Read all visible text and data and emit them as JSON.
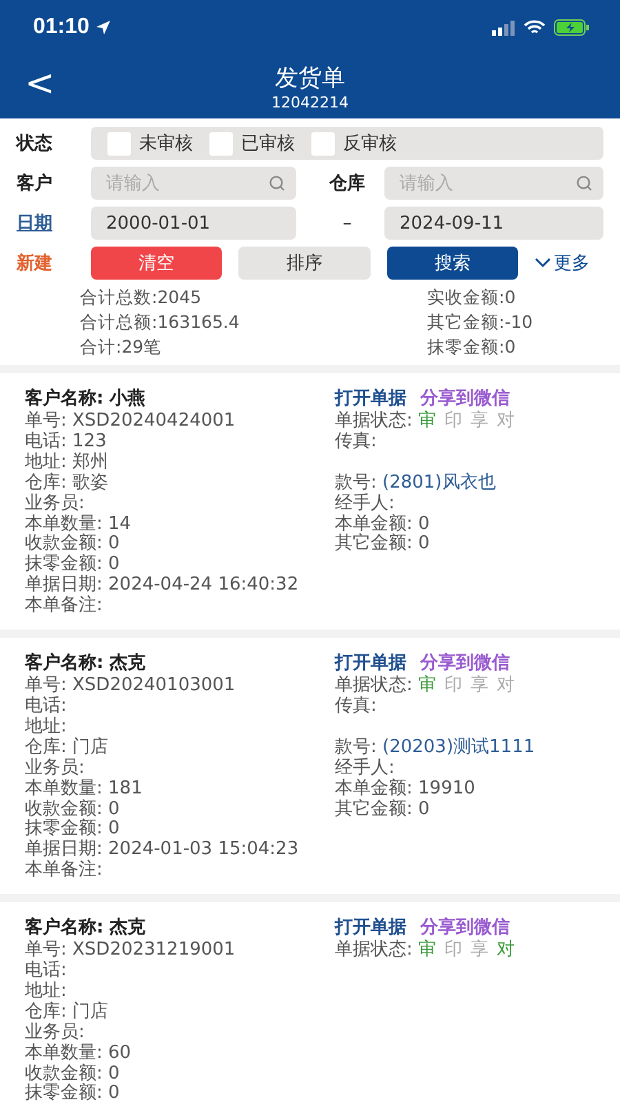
{
  "status_bar": {
    "time": "01:10"
  },
  "nav": {
    "back": "<",
    "title": "发货单",
    "subtitle": "12042214"
  },
  "filters": {
    "status_label": "状态",
    "status_options": [
      {
        "label": "未审核",
        "checked": false
      },
      {
        "label": "已审核",
        "checked": false
      },
      {
        "label": "反审核",
        "checked": false
      }
    ],
    "customer_label": "客户",
    "customer_placeholder": "请输入",
    "warehouse_label": "仓库",
    "warehouse_placeholder": "请输入",
    "date_label": "日期",
    "date_from": "2000-01-01",
    "date_sep": "–",
    "date_to": "2024-09-11",
    "new_label": "新建",
    "clear": "清空",
    "sort": "排序",
    "search": "搜索",
    "more": "更多"
  },
  "summary": {
    "left": [
      "合计总数:2045",
      "合计总额:163165.4",
      "合计:29笔"
    ],
    "right": [
      "实收金额:0",
      "其它金额:-10",
      "抹零金额:0"
    ]
  },
  "orders": [
    {
      "customer_label": "客户名称:",
      "customer": "小燕",
      "open": "打开单据",
      "share": "分享到微信",
      "rows": [
        {
          "left": {
            "label": "单号:",
            "value": "XSD20240424001"
          },
          "right": {
            "kind": "status",
            "label": "单据状态:",
            "flags": [
              {
                "text": "审",
                "on": true
              },
              {
                "text": "印",
                "on": false
              },
              {
                "text": "享",
                "on": false
              },
              {
                "text": "对",
                "on": false
              }
            ]
          }
        },
        {
          "left": {
            "label": "电话:",
            "value": "123"
          },
          "right": {
            "kind": "field",
            "label": "传真:"
          }
        },
        {
          "left": {
            "label": "地址:",
            "value": "郑州"
          }
        },
        {
          "left": {
            "label": "仓库:",
            "value": "歌姿"
          },
          "right": {
            "kind": "style",
            "label": "款号:",
            "value": "(2801)风衣也"
          }
        },
        {
          "left": {
            "label": "业务员:"
          },
          "right": {
            "kind": "field",
            "label": "经手人:"
          }
        },
        {
          "left": {
            "label": "本单数量:",
            "value": "14"
          },
          "right": {
            "kind": "field",
            "label": "本单金额:",
            "value": "0"
          }
        },
        {
          "left": {
            "label": "收款金额:",
            "value": "0"
          },
          "right": {
            "kind": "field",
            "label": "其它金额:",
            "value": "0"
          }
        },
        {
          "left": {
            "label": "抹零金额:",
            "value": "0"
          }
        },
        {
          "left": {
            "label": "单据日期:",
            "value": "2024-04-24 16:40:32"
          }
        },
        {
          "left": {
            "label": "本单备注:"
          }
        }
      ]
    },
    {
      "customer_label": "客户名称:",
      "customer": "杰克",
      "open": "打开单据",
      "share": "分享到微信",
      "rows": [
        {
          "left": {
            "label": "单号:",
            "value": "XSD20240103001"
          },
          "right": {
            "kind": "status",
            "label": "单据状态:",
            "flags": [
              {
                "text": "审",
                "on": true
              },
              {
                "text": "印",
                "on": false
              },
              {
                "text": "享",
                "on": false
              },
              {
                "text": "对",
                "on": false
              }
            ]
          }
        },
        {
          "left": {
            "label": "电话:"
          },
          "right": {
            "kind": "field",
            "label": "传真:"
          }
        },
        {
          "left": {
            "label": "地址:"
          }
        },
        {
          "left": {
            "label": "仓库:",
            "value": "门店"
          },
          "right": {
            "kind": "style",
            "label": "款号:",
            "value": "(20203)测试1111"
          }
        },
        {
          "left": {
            "label": "业务员:"
          },
          "right": {
            "kind": "field",
            "label": "经手人:"
          }
        },
        {
          "left": {
            "label": "本单数量:",
            "value": "181"
          },
          "right": {
            "kind": "field",
            "label": "本单金额:",
            "value": "19910"
          }
        },
        {
          "left": {
            "label": "收款金额:",
            "value": "0"
          },
          "right": {
            "kind": "field",
            "label": "其它金额:",
            "value": "0"
          }
        },
        {
          "left": {
            "label": "抹零金额:",
            "value": "0"
          }
        },
        {
          "left": {
            "label": "单据日期:",
            "value": "2024-01-03 15:04:23"
          }
        },
        {
          "left": {
            "label": "本单备注:"
          }
        }
      ]
    },
    {
      "customer_label": "客户名称:",
      "customer": "杰克",
      "open": "打开单据",
      "share": "分享到微信",
      "rows": [
        {
          "left": {
            "label": "单号:",
            "value": "XSD20231219001"
          },
          "right": {
            "kind": "status",
            "label": "单据状态:",
            "flags": [
              {
                "text": "审",
                "on": true
              },
              {
                "text": "印",
                "on": false
              },
              {
                "text": "享",
                "on": false
              },
              {
                "text": "对",
                "on": true
              }
            ]
          }
        },
        {
          "left": {
            "label": "电话:"
          }
        },
        {
          "left": {
            "label": "地址:"
          }
        },
        {
          "left": {
            "label": "仓库:",
            "value": "门店"
          }
        },
        {
          "left": {
            "label": "业务员:"
          }
        },
        {
          "left": {
            "label": "本单数量:",
            "value": "60"
          }
        },
        {
          "left": {
            "label": "收款金额:",
            "value": "0"
          }
        },
        {
          "left": {
            "label": "抹零金额:",
            "value": "0"
          }
        }
      ]
    }
  ]
}
